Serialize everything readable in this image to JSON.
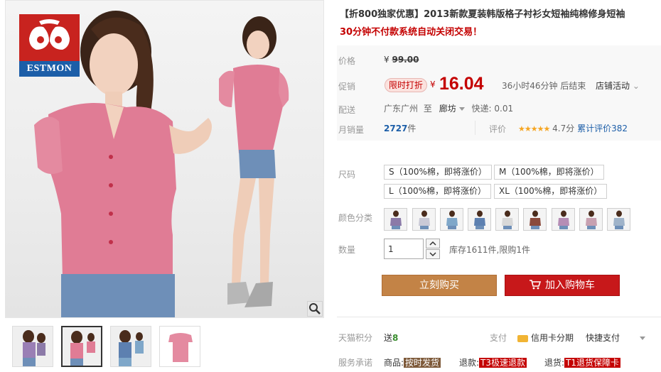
{
  "product": {
    "title": "【折800独家优惠】2013新款夏装韩版格子衬衫女短袖纯棉修身短袖",
    "subtitle": "30分钟不付款系统自动关闭交易！"
  },
  "brand": {
    "logo_text": "ESTMON"
  },
  "price": {
    "label": "价格",
    "currency": "¥",
    "original": "99.00",
    "promo_label": "促销",
    "promo_tag": "限时打折",
    "promo_value": "16.04",
    "promo_countdown": "36小时46分钟 后结束",
    "store_activity": "店铺活动"
  },
  "shipping": {
    "label": "配送",
    "from": "广东广州",
    "to_label": "至",
    "to": "廊坊",
    "express": "快递: 0.01"
  },
  "sales": {
    "label": "月销量",
    "count": "2727",
    "unit": "件"
  },
  "rating": {
    "label": "评价",
    "stars": "★★★★★",
    "score": "4.7分",
    "total": "累计评价382"
  },
  "sizes": {
    "label": "尺码",
    "options": [
      "S（100%棉，即将涨价）",
      "M（100%棉，即将涨价）",
      "L（100%棉，即将涨价）",
      "XL（100%棉，即将涨价）"
    ]
  },
  "colors": {
    "label": "颜色分类",
    "swatches": [
      "#8b7aa8",
      "#c9c9d6",
      "#7fa7c9",
      "#5d80b0",
      "#d8d8d8",
      "#8a4a3c",
      "#b58db5",
      "#c7a0b0",
      "#9fb3c9"
    ]
  },
  "quantity": {
    "label": "数量",
    "value": "1",
    "stock": "库存1611件,限购1件"
  },
  "actions": {
    "buy_now": "立刻购买",
    "add_to_cart": "加入购物车"
  },
  "footer": {
    "points_label": "天猫积分",
    "points_prefix": "送",
    "points_value": "8",
    "pay_label": "支付",
    "credit_installment": "信用卡分期",
    "express_pay": "快捷支付",
    "service_label": "服务承诺",
    "services": [
      {
        "prefix": "商品:",
        "tag": "按时发货"
      },
      {
        "prefix": "退款:",
        "tag": "T3极速退款"
      },
      {
        "prefix": "退货:",
        "tag": "T1退货保障卡"
      }
    ]
  },
  "colors_theme": {
    "accent_red": "#c40000",
    "buy_button": "#c38346",
    "cart_button": "#c7181a",
    "link_blue": "#1c5ea8"
  }
}
